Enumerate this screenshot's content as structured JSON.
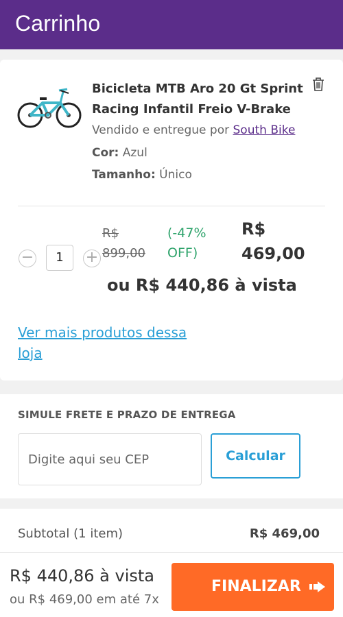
{
  "header": {
    "title": "Carrinho"
  },
  "product": {
    "title": "Bicicleta MTB Aro 20 Gt Sprint Racing Infantil Freio V-Brake",
    "sold_by_prefix": "Vendido e entregue por ",
    "seller": "South Bike",
    "color_label": "Cor:",
    "color_value": "Azul",
    "size_label": "Tamanho:",
    "size_value": "Único",
    "image_icon": "bicycle-image",
    "delete_icon": "trash-icon"
  },
  "pricing": {
    "quantity": "1",
    "minus_symbol": "−",
    "plus_symbol": "+",
    "old_price": "R$ 899,00",
    "discount": "(-47% OFF)",
    "new_price": "R$ 469,00",
    "cash_price": "ou R$ 440,86 à vista"
  },
  "store_link": "Ver mais produtos dessa loja",
  "shipping": {
    "title": "SIMULE FRETE E PRAZO DE ENTREGA",
    "cep_placeholder": "Digite aqui seu CEP",
    "button": "Calcular"
  },
  "summary": {
    "subtotal_label": "Subtotal (1 item)",
    "subtotal_value": "R$ 469,00"
  },
  "footer": {
    "price": "R$ 440,86 à vista",
    "installments": "ou R$ 469,00 em até 7x",
    "checkout_button": "FINALIZAR",
    "checkout_icon": "arrow-right-icon"
  },
  "colors": {
    "header_bg": "#5b2d8a",
    "discount": "#2ea36b",
    "link": "#2a9fd6",
    "checkout": "#ff6a26",
    "bike": "#3fb6c8"
  }
}
